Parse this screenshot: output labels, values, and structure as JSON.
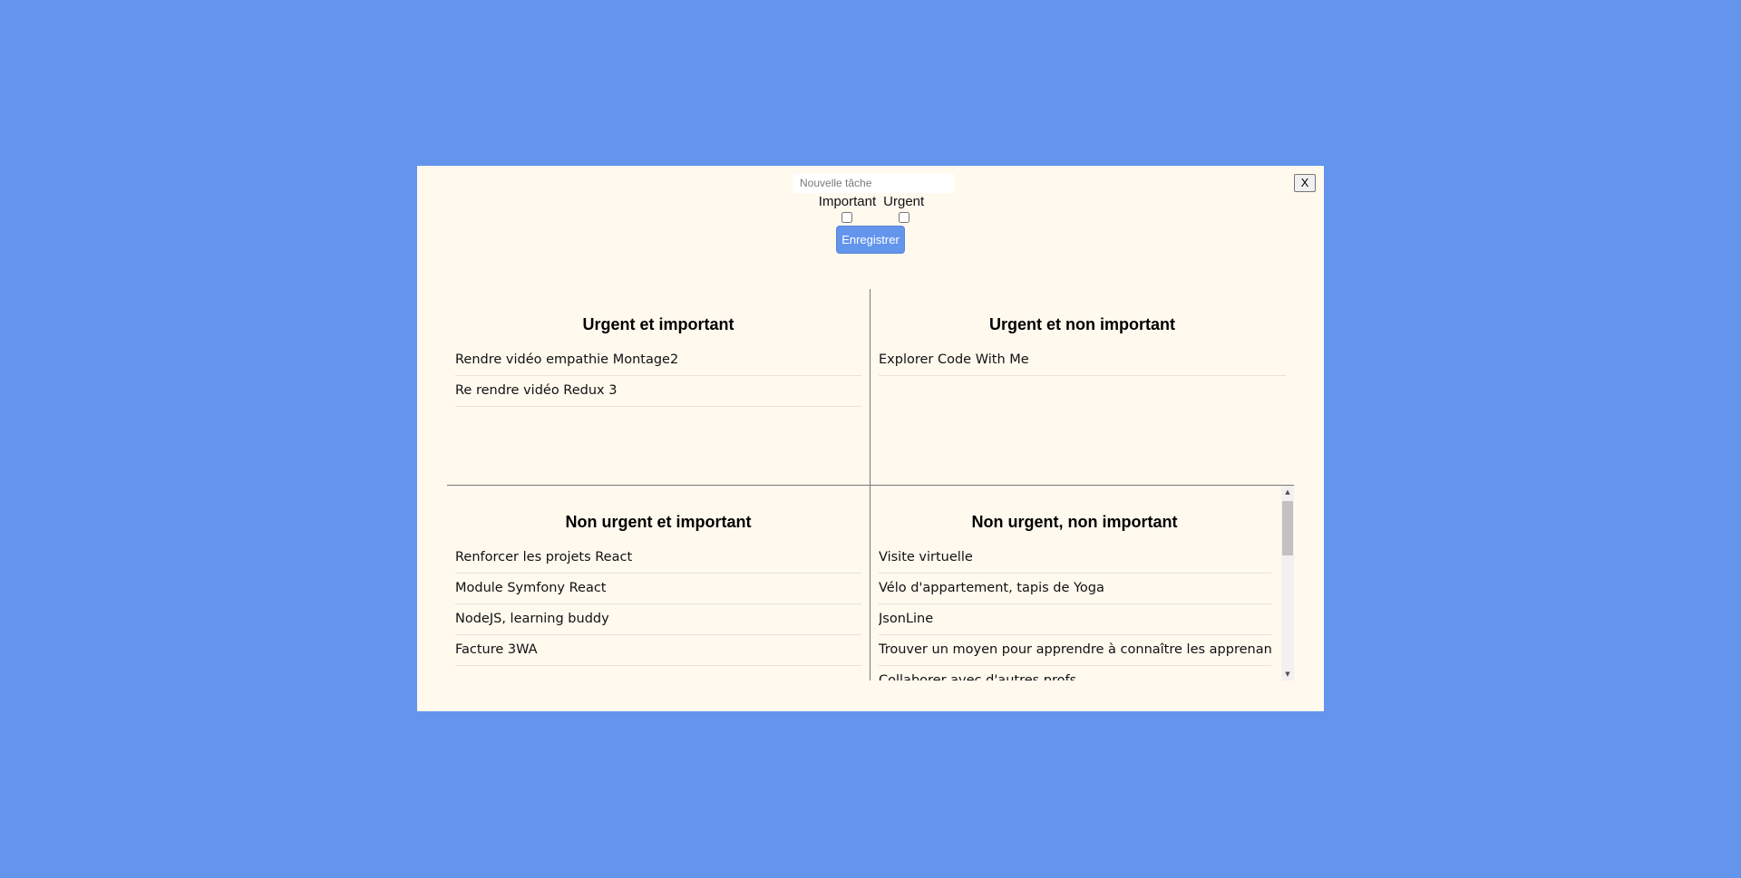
{
  "form": {
    "task_placeholder": "Nouvelle tâche",
    "important_label": "Important",
    "urgent_label": "Urgent",
    "save_label": "Enregistrer",
    "close_label": "X"
  },
  "quadrants": {
    "urgent_important": {
      "title": "Urgent et important",
      "tasks": [
        "Rendre vidéo empathie Montage2",
        "Re rendre vidéo Redux 3"
      ]
    },
    "urgent_not_important": {
      "title": "Urgent et non important",
      "tasks": [
        "Explorer Code With Me"
      ]
    },
    "not_urgent_important": {
      "title": "Non urgent et important",
      "tasks": [
        "Renforcer les projets React",
        "Module Symfony React",
        "NodeJS, learning buddy",
        "Facture 3WA"
      ]
    },
    "not_urgent_not_important": {
      "title": "Non urgent, non important",
      "tasks": [
        "Visite virtuelle",
        "Vélo d'appartement, tapis de Yoga",
        "JsonLine",
        "Trouver un moyen pour apprendre à connaître les apprenants",
        "Collaborer avec d'autres profs"
      ]
    }
  },
  "scrollbar": {
    "up_icon": "▲",
    "down_icon": "▼"
  },
  "colors": {
    "background": "#6495ED",
    "modal": "#FFF9EE",
    "button": "#6495ED"
  }
}
